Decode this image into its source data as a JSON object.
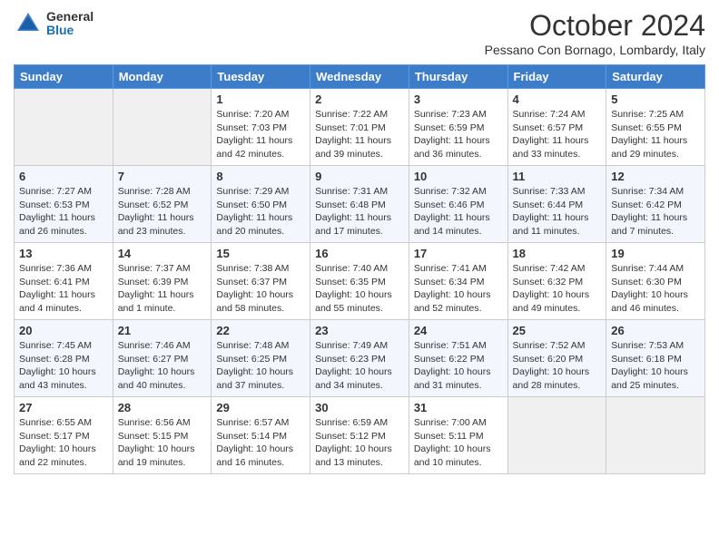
{
  "header": {
    "logo": {
      "general": "General",
      "blue": "Blue"
    },
    "title": "October 2024",
    "subtitle": "Pessano Con Bornago, Lombardy, Italy"
  },
  "days_of_week": [
    "Sunday",
    "Monday",
    "Tuesday",
    "Wednesday",
    "Thursday",
    "Friday",
    "Saturday"
  ],
  "weeks": [
    [
      {
        "num": "",
        "sunrise": "",
        "sunset": "",
        "daylight": ""
      },
      {
        "num": "",
        "sunrise": "",
        "sunset": "",
        "daylight": ""
      },
      {
        "num": "1",
        "sunrise": "Sunrise: 7:20 AM",
        "sunset": "Sunset: 7:03 PM",
        "daylight": "Daylight: 11 hours and 42 minutes."
      },
      {
        "num": "2",
        "sunrise": "Sunrise: 7:22 AM",
        "sunset": "Sunset: 7:01 PM",
        "daylight": "Daylight: 11 hours and 39 minutes."
      },
      {
        "num": "3",
        "sunrise": "Sunrise: 7:23 AM",
        "sunset": "Sunset: 6:59 PM",
        "daylight": "Daylight: 11 hours and 36 minutes."
      },
      {
        "num": "4",
        "sunrise": "Sunrise: 7:24 AM",
        "sunset": "Sunset: 6:57 PM",
        "daylight": "Daylight: 11 hours and 33 minutes."
      },
      {
        "num": "5",
        "sunrise": "Sunrise: 7:25 AM",
        "sunset": "Sunset: 6:55 PM",
        "daylight": "Daylight: 11 hours and 29 minutes."
      }
    ],
    [
      {
        "num": "6",
        "sunrise": "Sunrise: 7:27 AM",
        "sunset": "Sunset: 6:53 PM",
        "daylight": "Daylight: 11 hours and 26 minutes."
      },
      {
        "num": "7",
        "sunrise": "Sunrise: 7:28 AM",
        "sunset": "Sunset: 6:52 PM",
        "daylight": "Daylight: 11 hours and 23 minutes."
      },
      {
        "num": "8",
        "sunrise": "Sunrise: 7:29 AM",
        "sunset": "Sunset: 6:50 PM",
        "daylight": "Daylight: 11 hours and 20 minutes."
      },
      {
        "num": "9",
        "sunrise": "Sunrise: 7:31 AM",
        "sunset": "Sunset: 6:48 PM",
        "daylight": "Daylight: 11 hours and 17 minutes."
      },
      {
        "num": "10",
        "sunrise": "Sunrise: 7:32 AM",
        "sunset": "Sunset: 6:46 PM",
        "daylight": "Daylight: 11 hours and 14 minutes."
      },
      {
        "num": "11",
        "sunrise": "Sunrise: 7:33 AM",
        "sunset": "Sunset: 6:44 PM",
        "daylight": "Daylight: 11 hours and 11 minutes."
      },
      {
        "num": "12",
        "sunrise": "Sunrise: 7:34 AM",
        "sunset": "Sunset: 6:42 PM",
        "daylight": "Daylight: 11 hours and 7 minutes."
      }
    ],
    [
      {
        "num": "13",
        "sunrise": "Sunrise: 7:36 AM",
        "sunset": "Sunset: 6:41 PM",
        "daylight": "Daylight: 11 hours and 4 minutes."
      },
      {
        "num": "14",
        "sunrise": "Sunrise: 7:37 AM",
        "sunset": "Sunset: 6:39 PM",
        "daylight": "Daylight: 11 hours and 1 minute."
      },
      {
        "num": "15",
        "sunrise": "Sunrise: 7:38 AM",
        "sunset": "Sunset: 6:37 PM",
        "daylight": "Daylight: 10 hours and 58 minutes."
      },
      {
        "num": "16",
        "sunrise": "Sunrise: 7:40 AM",
        "sunset": "Sunset: 6:35 PM",
        "daylight": "Daylight: 10 hours and 55 minutes."
      },
      {
        "num": "17",
        "sunrise": "Sunrise: 7:41 AM",
        "sunset": "Sunset: 6:34 PM",
        "daylight": "Daylight: 10 hours and 52 minutes."
      },
      {
        "num": "18",
        "sunrise": "Sunrise: 7:42 AM",
        "sunset": "Sunset: 6:32 PM",
        "daylight": "Daylight: 10 hours and 49 minutes."
      },
      {
        "num": "19",
        "sunrise": "Sunrise: 7:44 AM",
        "sunset": "Sunset: 6:30 PM",
        "daylight": "Daylight: 10 hours and 46 minutes."
      }
    ],
    [
      {
        "num": "20",
        "sunrise": "Sunrise: 7:45 AM",
        "sunset": "Sunset: 6:28 PM",
        "daylight": "Daylight: 10 hours and 43 minutes."
      },
      {
        "num": "21",
        "sunrise": "Sunrise: 7:46 AM",
        "sunset": "Sunset: 6:27 PM",
        "daylight": "Daylight: 10 hours and 40 minutes."
      },
      {
        "num": "22",
        "sunrise": "Sunrise: 7:48 AM",
        "sunset": "Sunset: 6:25 PM",
        "daylight": "Daylight: 10 hours and 37 minutes."
      },
      {
        "num": "23",
        "sunrise": "Sunrise: 7:49 AM",
        "sunset": "Sunset: 6:23 PM",
        "daylight": "Daylight: 10 hours and 34 minutes."
      },
      {
        "num": "24",
        "sunrise": "Sunrise: 7:51 AM",
        "sunset": "Sunset: 6:22 PM",
        "daylight": "Daylight: 10 hours and 31 minutes."
      },
      {
        "num": "25",
        "sunrise": "Sunrise: 7:52 AM",
        "sunset": "Sunset: 6:20 PM",
        "daylight": "Daylight: 10 hours and 28 minutes."
      },
      {
        "num": "26",
        "sunrise": "Sunrise: 7:53 AM",
        "sunset": "Sunset: 6:18 PM",
        "daylight": "Daylight: 10 hours and 25 minutes."
      }
    ],
    [
      {
        "num": "27",
        "sunrise": "Sunrise: 6:55 AM",
        "sunset": "Sunset: 5:17 PM",
        "daylight": "Daylight: 10 hours and 22 minutes."
      },
      {
        "num": "28",
        "sunrise": "Sunrise: 6:56 AM",
        "sunset": "Sunset: 5:15 PM",
        "daylight": "Daylight: 10 hours and 19 minutes."
      },
      {
        "num": "29",
        "sunrise": "Sunrise: 6:57 AM",
        "sunset": "Sunset: 5:14 PM",
        "daylight": "Daylight: 10 hours and 16 minutes."
      },
      {
        "num": "30",
        "sunrise": "Sunrise: 6:59 AM",
        "sunset": "Sunset: 5:12 PM",
        "daylight": "Daylight: 10 hours and 13 minutes."
      },
      {
        "num": "31",
        "sunrise": "Sunrise: 7:00 AM",
        "sunset": "Sunset: 5:11 PM",
        "daylight": "Daylight: 10 hours and 10 minutes."
      },
      {
        "num": "",
        "sunrise": "",
        "sunset": "",
        "daylight": ""
      },
      {
        "num": "",
        "sunrise": "",
        "sunset": "",
        "daylight": ""
      }
    ]
  ]
}
